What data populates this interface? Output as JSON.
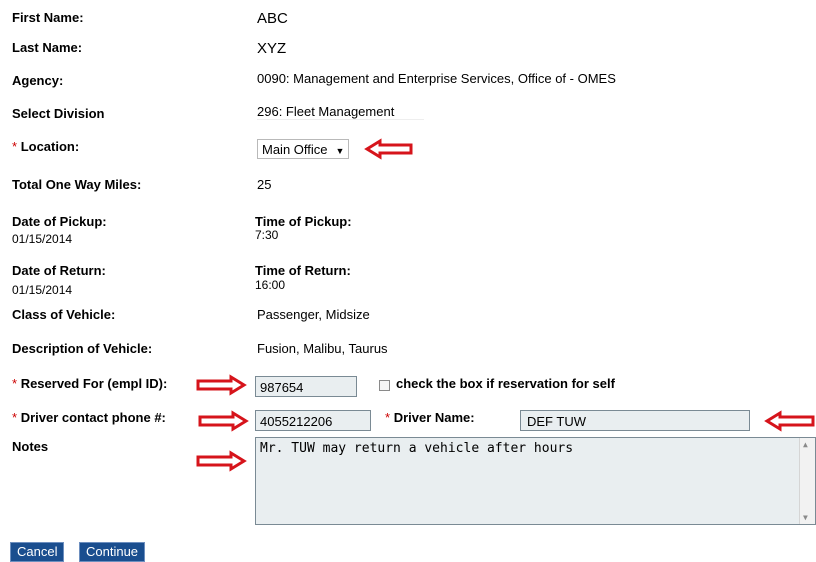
{
  "form": {
    "first_name": {
      "label": "First Name:",
      "value": "ABC"
    },
    "last_name": {
      "label": "Last Name:",
      "value": "XYZ"
    },
    "agency": {
      "label": "Agency:",
      "value": "0090: Management and Enterprise Services, Office of - OMES"
    },
    "division": {
      "label": "Select Division",
      "value": "296: Fleet Management"
    },
    "location": {
      "required_mark": "*",
      "label": "Location:",
      "selected": "Main Office",
      "caret": "▼"
    },
    "miles": {
      "label": "Total One Way Miles:",
      "value": "25"
    },
    "pickup_date": {
      "label": "Date of Pickup:",
      "value": "01/15/2014"
    },
    "pickup_time": {
      "label": "Time of Pickup:",
      "value": "7:30"
    },
    "return_date": {
      "label": "Date of Return:",
      "value": "01/15/2014"
    },
    "return_time": {
      "label": "Time of Return:",
      "value": "16:00"
    },
    "vehicle_class": {
      "label": "Class of Vehicle:",
      "value": "Passenger, Midsize"
    },
    "vehicle_desc": {
      "label": "Description of Vehicle:",
      "value": "Fusion, Malibu, Taurus"
    },
    "reserved_for": {
      "required_mark": "*",
      "label": "Reserved For (empl ID):",
      "value": "987654"
    },
    "self_checkbox": {
      "label": "check the box if reservation for self",
      "checked": false
    },
    "driver_phone": {
      "required_mark": "*",
      "label": "Driver contact phone #:",
      "value": "4055212206"
    },
    "driver_name": {
      "required_mark": "*",
      "label": "Driver Name:",
      "value": "DEF TUW"
    },
    "notes": {
      "label": "Notes",
      "value": "Mr. TUW may return a vehicle after hours"
    }
  },
  "buttons": {
    "cancel": "Cancel",
    "continue": "Continue"
  },
  "colors": {
    "arrow": "#d6141b",
    "button_bg": "#1a4e8f",
    "input_bg": "#e9eef0",
    "required": "#cc0000"
  }
}
